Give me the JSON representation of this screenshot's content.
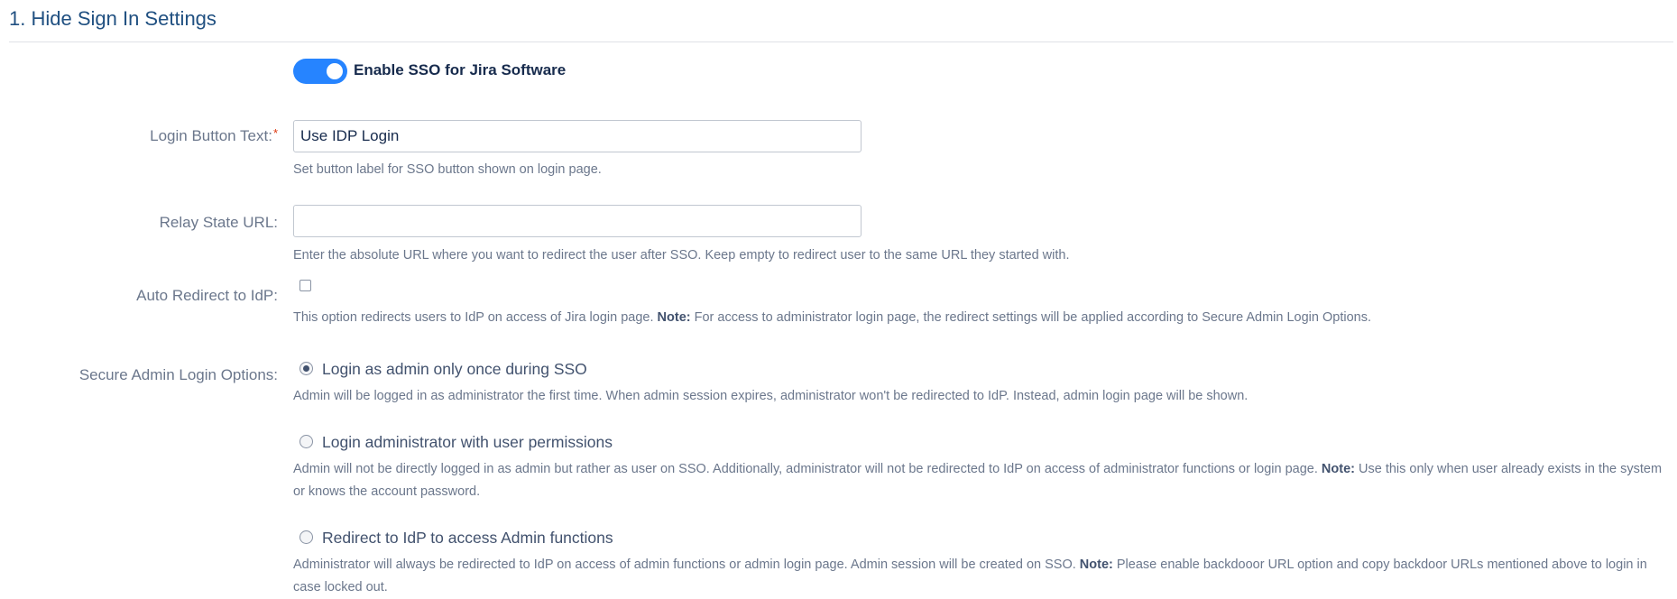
{
  "section": {
    "title": "1. Hide Sign In Settings"
  },
  "sso_toggle": {
    "label": "Enable SSO for Jira Software",
    "enabled": true
  },
  "login_button_text": {
    "label": "Login Button Text:",
    "required_mark": "*",
    "value": "Use IDP Login",
    "help": "Set button label for SSO button shown on login page."
  },
  "relay_state_url": {
    "label": "Relay State URL:",
    "value": "",
    "help": "Enter the absolute URL where you want to redirect the user after SSO. Keep empty to redirect user to the same URL they started with."
  },
  "auto_redirect": {
    "label": "Auto Redirect to IdP:",
    "checked": false,
    "help_text": "This option redirects users to IdP on access of Jira login page. ",
    "help_note_label": "Note:",
    "help_note": " For access to administrator login page, the redirect settings will be applied according to Secure Admin Login Options."
  },
  "secure_admin": {
    "label": "Secure Admin Login Options:",
    "options": [
      {
        "label": "Login as admin only once during SSO",
        "checked": true,
        "help_text": "Admin will be logged in as administrator the first time. When admin session expires, administrator won't be redirected to IdP. Instead, admin login page will be shown.",
        "help_note_label": "",
        "help_note": "",
        "help_tail": ""
      },
      {
        "label": "Login administrator with user permissions",
        "checked": false,
        "help_text": "Admin will not be directly logged in as admin but rather as user on SSO. Additionally, administrator will not be redirected to IdP on access of administrator functions or login page. ",
        "help_note_label": "Note:",
        "help_note": " Use this only when user already exists in the system or knows the account password."
      },
      {
        "label": "Redirect to IdP to access Admin functions",
        "checked": false,
        "help_text": "Administrator will always be redirected to IdP on access of admin functions or admin login page. Admin session will be created on SSO. ",
        "help_note_label": "Note:",
        "help_note": " Please enable backdooor URL option and copy backdoor URLs mentioned above to login in case locked out."
      }
    ]
  },
  "colors": {
    "title": "#205081",
    "toggle_on": "#2684ff",
    "required": "#de350b"
  }
}
